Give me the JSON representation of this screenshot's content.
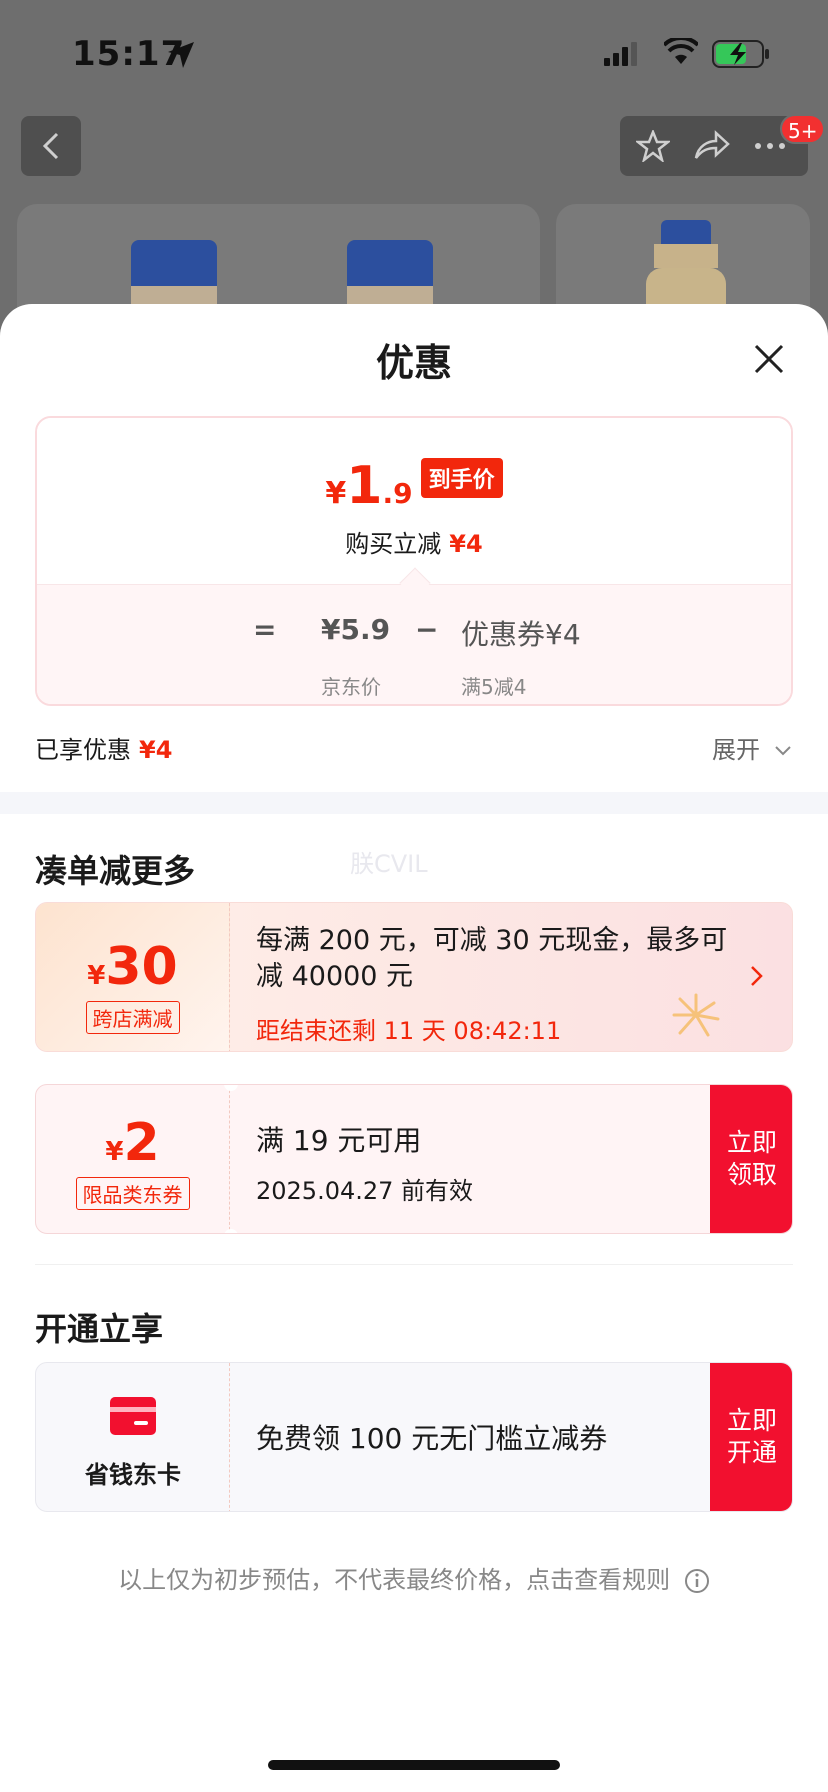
{
  "status_bar": {
    "time": "15:17"
  },
  "nav": {
    "badge": "5+"
  },
  "sheet": {
    "title": "优惠"
  },
  "price": {
    "currency": "¥",
    "integer": "1",
    "decimal": ".9",
    "tag": "到手价",
    "instant_discount_label": "购买立减",
    "instant_discount_value": "¥4",
    "equals": "=",
    "jd_price": "¥5.9",
    "minus": "−",
    "coupon": "优惠券¥4",
    "jd_price_label": "京东价",
    "coupon_rule": "满5减4"
  },
  "enjoyed": {
    "label": "已享优惠",
    "value": "¥4",
    "expand": "展开"
  },
  "section_more": {
    "title": "凑单减更多",
    "watermark": "朕CVIL"
  },
  "promo_cross_store": {
    "currency": "¥",
    "amount": "30",
    "tag": "跨店满减",
    "desc": "每满 200 元，可减 30 元现金，最多可减 40000 元",
    "countdown": "距结束还剩 11 天 08:42:11"
  },
  "coupon_category": {
    "currency": "¥",
    "amount": "2",
    "tag": "限品类东券",
    "condition": "满 19 元可用",
    "validity": "2025.04.27 前有效",
    "action": "立即领取"
  },
  "section_open": {
    "title": "开通立享"
  },
  "savings_card": {
    "name": "省钱东卡",
    "offer": "免费领 100 元无门槛立减券",
    "action": "立即开通"
  },
  "footnote": "以上仅为初步预估，不代表最终价格，点击查看规则",
  "colors": {
    "accent": "#f2270c",
    "action_red": "#f2102f"
  }
}
